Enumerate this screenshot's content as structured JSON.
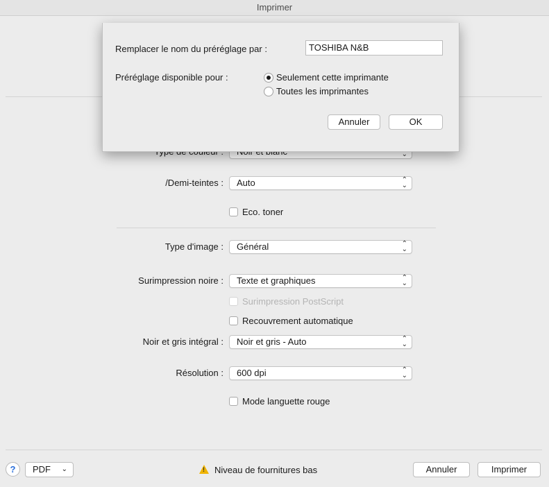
{
  "window": {
    "title": "Imprimer"
  },
  "form": {
    "type_couleur_label": "Type de couleur :",
    "type_couleur_value": "Noir et blanc",
    "demi_teintes_label": "/Demi-teintes :",
    "demi_teintes_value": "Auto",
    "eco_toner": "Eco. toner",
    "type_image_label": "Type d'image :",
    "type_image_value": "Général",
    "surimpression_label": "Surimpression noire :",
    "surimpression_value": "Texte et graphiques",
    "surimpression_ps": "Surimpression PostScript",
    "recouvrement": "Recouvrement automatique",
    "noir_gris_label": "Noir et gris intégral :",
    "noir_gris_value": "Noir et gris - Auto",
    "resolution_label": "Résolution :",
    "resolution_value": "600 dpi",
    "languette": "Mode languette rouge"
  },
  "footer": {
    "help": "?",
    "pdf": "PDF",
    "status": "Niveau de fournitures bas",
    "cancel": "Annuler",
    "print": "Imprimer"
  },
  "sheet": {
    "rename_label": "Remplacer le nom du préréglage par :",
    "rename_value": "TOSHIBA N&B",
    "available_label": "Préréglage disponible pour :",
    "option_this": "Seulement cette imprimante",
    "option_all": "Toutes les imprimantes",
    "cancel": "Annuler",
    "ok": "OK"
  },
  "colors": {
    "accent": "#2a6fdb",
    "warning": "#f0b400"
  }
}
